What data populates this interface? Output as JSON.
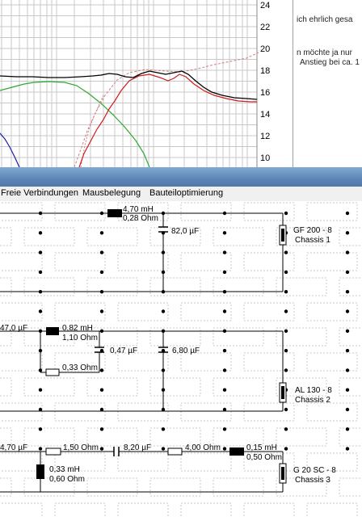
{
  "graph": {
    "y_ticks": [
      "24",
      "22",
      "20",
      "18",
      "16",
      "14",
      "12",
      "10"
    ],
    "colors": {
      "grid": "#c8c8c8",
      "total": "#000000",
      "bass": "#2ea82e",
      "tweeter": "#d11a1a",
      "sim_dashed": "#d08080",
      "woofer": "#1a1aa8"
    }
  },
  "side_notes": [
    "ich ehrlich gesa",
    "n möchte ja nur",
    "Anstieg bei ca. 1"
  ],
  "menu": [
    "Freie Verbindungen",
    "Mausbelegung",
    "Bauteiloptimierung"
  ],
  "circuits": [
    {
      "inductor": "4,70 mH",
      "inductor_resistance": "0,28 Ohm",
      "capacitor": "82,0 µF",
      "driver": {
        "name": "GF 200 - 8",
        "chassis": "Chassis 1"
      }
    },
    {
      "input_capacitor": "47,0 µF",
      "inductor": "0,82 mH",
      "inductor_resistance": "1,10 Ohm",
      "resistor": "0,33 Ohm",
      "capacitor_a": "0,47 µF",
      "capacitor_b": "6,80 µF",
      "driver": {
        "name": "AL 130 - 8",
        "chassis": "Chassis 2"
      }
    },
    {
      "input_capacitor": "4,70 µF",
      "resistor_a": "1,50 Ohm",
      "capacitor": "8,20 µF",
      "resistor_b": "4,00 Ohm",
      "inductor": "0,15 mH",
      "inductor_resistance": "0,50 Ohm",
      "shunt_inductor": "0,33 mH",
      "shunt_resistance": "0,60 Ohm",
      "driver": {
        "name": "G 20 SC - 8",
        "chassis": "Chassis 3"
      }
    }
  ]
}
